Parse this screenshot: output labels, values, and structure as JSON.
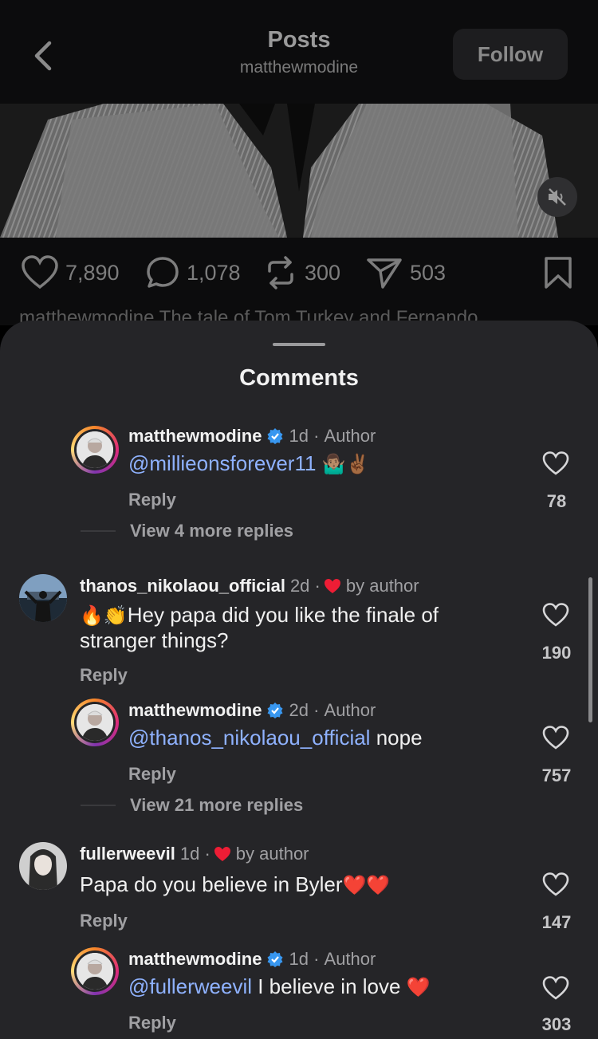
{
  "header": {
    "title": "Posts",
    "subtitle": "matthewmodine",
    "follow_label": "Follow"
  },
  "post": {
    "likes": "7,890",
    "comments": "1,078",
    "reposts": "300",
    "shares": "503",
    "caption": "matthewmodine The tale of Tom Turkey and Fernando"
  },
  "sheet": {
    "title": "Comments"
  },
  "comments": [
    {
      "username": "matthewmodine",
      "time": "1d",
      "badge": "Author",
      "mention": "@millieonsforever11",
      "text": "",
      "emoji": "🤷🏽‍♂️✌🏾",
      "reply_label": "Reply",
      "likes": "78",
      "more_replies": "View 4 more replies"
    },
    {
      "username": "thanos_nikolaou_official",
      "time": "2d",
      "badge": "by author",
      "emoji": "🔥👏",
      "text": "Hey papa did you like the finale of stranger things?",
      "reply_label": "Reply",
      "likes": "190"
    },
    {
      "username": "matthewmodine",
      "time": "2d",
      "badge": "Author",
      "mention": "@thanos_nikolaou_official",
      "text": " nope",
      "reply_label": "Reply",
      "likes": "757",
      "more_replies": "View 21 more replies"
    },
    {
      "username": "fullerweevil",
      "time": "1d",
      "badge": "by author",
      "text": "Papa do you believe in Byler",
      "emoji": "❤️❤️",
      "reply_label": "Reply",
      "likes": "147"
    },
    {
      "username": "matthewmodine",
      "time": "1d",
      "badge": "Author",
      "mention": "@fullerweevil",
      "text": " I believe in love",
      "emoji": "❤️",
      "reply_label": "Reply",
      "likes": "303"
    }
  ],
  "colors": {
    "accent_link": "#8fb2ff",
    "verified_blue": "#3897f0",
    "heart_red": "#ee1d35"
  }
}
